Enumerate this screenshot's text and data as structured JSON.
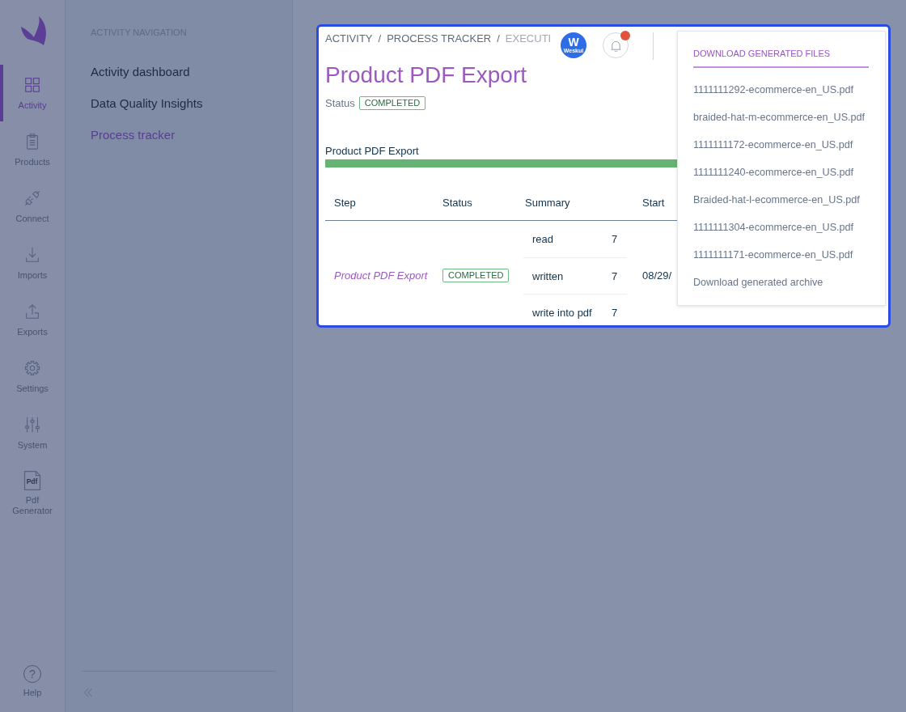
{
  "sidebar": {
    "items": [
      {
        "label": "Activity",
        "selected": true
      },
      {
        "label": "Products",
        "selected": false
      },
      {
        "label": "Connect",
        "selected": false
      },
      {
        "label": "Imports",
        "selected": false
      },
      {
        "label": "Exports",
        "selected": false
      },
      {
        "label": "Settings",
        "selected": false
      },
      {
        "label": "System",
        "selected": false
      },
      {
        "label": "Pdf Generator",
        "selected": false,
        "icon_text": "Pdf"
      }
    ],
    "help": {
      "label": "Help",
      "glyph": "?"
    }
  },
  "navigation": {
    "title": "ACTIVITY NAVIGATION",
    "items": [
      {
        "label": "Activity dashboard",
        "selected": false
      },
      {
        "label": "Data Quality Insights",
        "selected": false
      },
      {
        "label": "Process tracker",
        "selected": true
      }
    ]
  },
  "card": {
    "breadcrumb": [
      {
        "label": "ACTIVITY",
        "current": false
      },
      {
        "label": "PROCESS TRACKER",
        "current": false
      },
      {
        "label": "EXECUTI",
        "current": true
      }
    ],
    "breadcrumb_separators": [
      "/",
      "/"
    ],
    "avatar": {
      "mark": "W",
      "caption": "Weskul"
    },
    "notifications": {
      "unread": true
    },
    "title": "Product PDF Export",
    "status": {
      "label": "Status",
      "badge": "COMPLETED"
    },
    "progress": {
      "label": "Product PDF Export",
      "level": 1
    },
    "table": {
      "columns": [
        "Step",
        "Status",
        "Summary",
        "Start"
      ],
      "rows": [
        {
          "step": "Product PDF Export",
          "status": "COMPLETED",
          "summary": [
            {
              "label": "read",
              "value": "7"
            },
            {
              "label": "written",
              "value": "7"
            },
            {
              "label": "write into pdf",
              "value": "7"
            }
          ],
          "start": "08/29/"
        }
      ]
    },
    "download_menu": {
      "title": "DOWNLOAD GENERATED FILES",
      "files": [
        "1111111292-ecommerce-en_US.pdf",
        "braided-hat-m-ecommerce-en_US.pdf",
        "1111111172-ecommerce-en_US.pdf",
        "1111111240-ecommerce-en_US.pdf",
        "Braided-hat-l-ecommerce-en_US.pdf",
        "1111111304-ecommerce-en_US.pdf",
        "1111111171-ecommerce-en_US.pdf"
      ],
      "archive": "Download generated archive"
    }
  }
}
